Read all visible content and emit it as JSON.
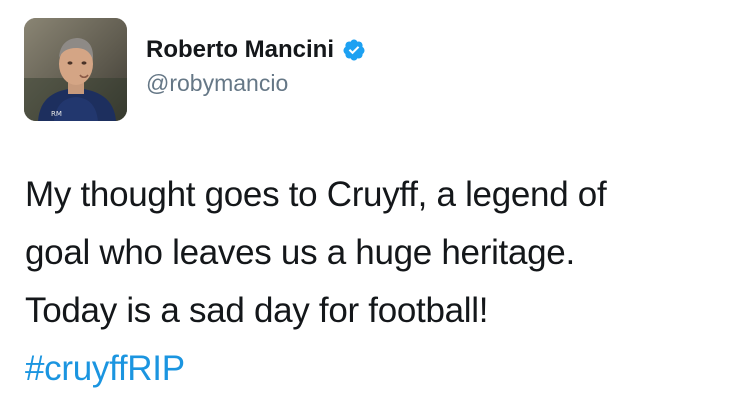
{
  "author": {
    "display_name": "Roberto Mancini",
    "username": "@robymancio",
    "verified": true,
    "avatar_icon": "profile-photo",
    "verified_icon": "verified-badge-icon"
  },
  "tweet": {
    "lines": [
      "My thought goes to Cruyff, a legend of",
      "goal who leaves us a huge heritage.",
      "Today is a sad day for football!"
    ],
    "hashtag": "#cruyffRIP"
  },
  "colors": {
    "text": "#14171a",
    "secondary_text": "#657786",
    "link": "#1b95e0",
    "verified_badge": "#1da1f2",
    "background": "#ffffff"
  }
}
